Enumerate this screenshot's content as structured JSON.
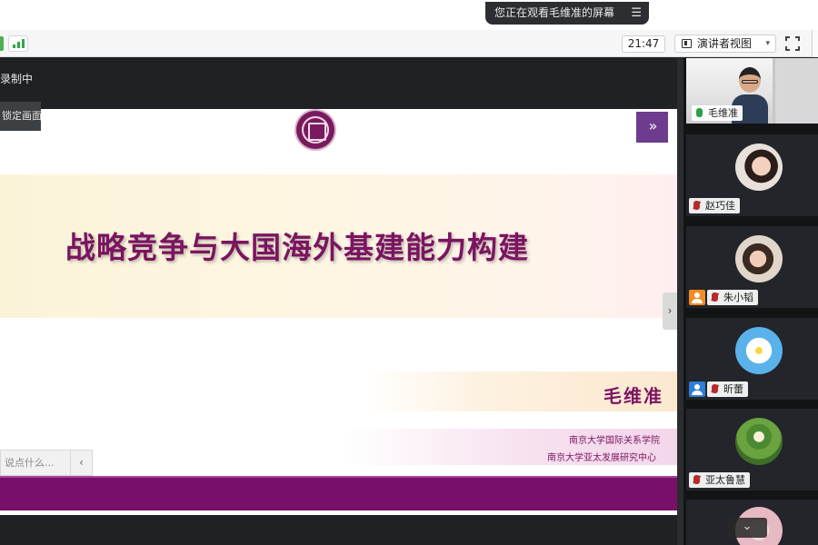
{
  "top": {
    "share_banner": "您正在观看毛维准的屏幕",
    "banner_menu": "☰"
  },
  "toolbar": {
    "time": "21:47",
    "view_label": "演讲者视图",
    "view_caret": "▾"
  },
  "main": {
    "recording": "录制中",
    "lock_view": "锁定画面",
    "chat_placeholder": "说点什么...",
    "chat_collapse": "‹",
    "slide_arrow": "›"
  },
  "slide": {
    "next": "»",
    "title": "战略竞争与大国海外基建能力构建",
    "author": "毛维准",
    "institution_1": "南京大学国际关系学院",
    "institution_2": "南京大学亚太发展研究中心",
    "colors": {
      "title": "#7b1461",
      "bottom_bar": "#7a0f6a",
      "next_button": "#6e3c8e"
    }
  },
  "gallery": {
    "participants": [
      {
        "name": "毛维准",
        "mic": "on",
        "video": true
      },
      {
        "name": "赵巧佳",
        "mic": "muted"
      },
      {
        "name": "朱小韬",
        "mic": "muted",
        "badge": "orange"
      },
      {
        "name": "昕蕾",
        "mic": "muted",
        "badge": "blue"
      },
      {
        "name": "亚太鲁慧",
        "mic": "muted"
      }
    ],
    "scroll_down": "⌄"
  }
}
